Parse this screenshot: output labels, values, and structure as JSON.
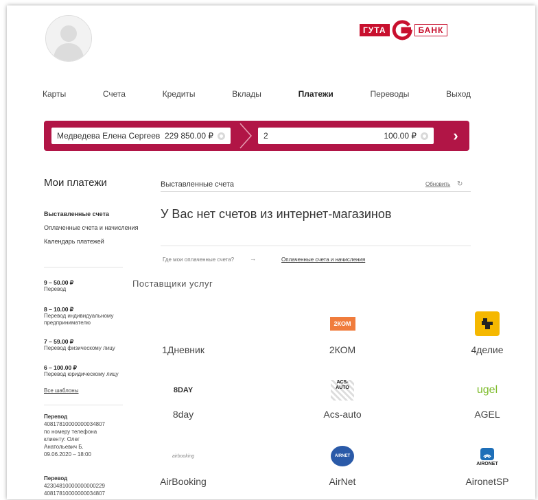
{
  "header": {
    "logo": {
      "left_text": "ГУТА",
      "right_text": "БАНК",
      "brand_color": "#c8102e"
    }
  },
  "nav": {
    "items": [
      "Карты",
      "Счета",
      "Кредиты",
      "Вклады",
      "Платежи",
      "Переводы",
      "Выход"
    ],
    "active": "Платежи"
  },
  "paybar": {
    "from_name": "Медведева Елена Сергеев...",
    "from_amount": "229 850.00 ₽",
    "to_value": "2",
    "to_amount": "100.00 ₽",
    "bar_color": "#b11546"
  },
  "sidebar": {
    "title": "Мои платежи",
    "menu": [
      "Выставленные счета",
      "Оплаченные счета и начисления",
      "Календарь платежей"
    ],
    "templates": [
      {
        "amount": "9 – 50.00 ₽",
        "desc": "Перевод"
      },
      {
        "amount": "8 – 10.00 ₽",
        "desc": "Перевод индивидуальному предпринимателю"
      },
      {
        "amount": "7 – 59.00 ₽",
        "desc": "Перевод физическому лицу"
      },
      {
        "amount": "6 – 100.00 ₽",
        "desc": "Перевод юридическому лицу"
      }
    ],
    "all_templates": "Все шаблоны",
    "transfers": [
      {
        "title": "Перевод",
        "lines": [
          "40817810000000034807",
          "по номеру телефона",
          "клиенту: Олег",
          "Анатольевич Б.",
          "09.06.2020 – 18:00"
        ]
      },
      {
        "title": "Перевод",
        "lines": [
          "42304810000000000229",
          "40817810000000034807"
        ]
      }
    ]
  },
  "main": {
    "tab": "Выставленные счета",
    "refresh": "Обновить",
    "empty_title": "У Вас нет счетов из интернет-магазинов",
    "crumb_question": "Где мои оплаченные счета?",
    "crumb_arrow": "→",
    "crumb_link": "Оплаченные счета и начисления",
    "providers_title": "Поставщики услуг",
    "providers": [
      {
        "name": "1Дневник",
        "logo": ""
      },
      {
        "name": "2КОМ",
        "logo": "2КОМ",
        "color": "#f07c3c"
      },
      {
        "name": "4делие",
        "logo": "chip",
        "color": "#f5b800"
      },
      {
        "name": "8day",
        "logo": "8DAY"
      },
      {
        "name": "Acs-auto",
        "logo": "ACS-AUTO"
      },
      {
        "name": "AGEL",
        "logo": "ugel",
        "color": "#7dbb2a"
      },
      {
        "name": "AirBooking",
        "logo": "airbooking"
      },
      {
        "name": "AirNet",
        "logo": "AIRNET",
        "color": "#2a5aa8"
      },
      {
        "name": "AironetSP",
        "logo": "AIRONET",
        "color": "#1e6fb8"
      }
    ]
  }
}
